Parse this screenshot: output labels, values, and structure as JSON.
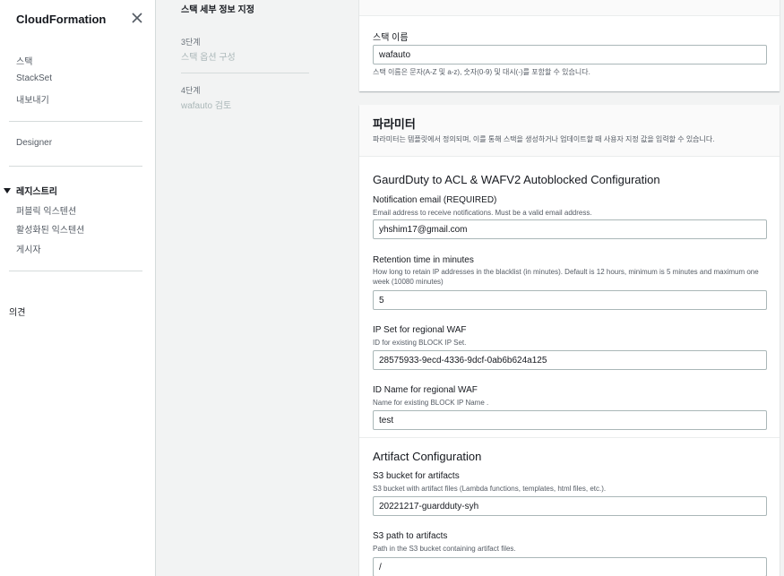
{
  "sidebar": {
    "title": "CloudFormation",
    "items": [
      "스택",
      "StackSet",
      "내보내기"
    ],
    "designer": "Designer",
    "registry": {
      "label": "레지스트리",
      "items": [
        "퍼블릭 익스텐션",
        "활성화된 익스텐션",
        "게시자"
      ]
    },
    "feedback": "의견"
  },
  "steps": {
    "current": "스택 세부 정보 지정",
    "step3_num": "3단계",
    "step3_name": "스택 옵션 구성",
    "step4_num": "4단계",
    "step4_name": "wafauto 검토"
  },
  "stack_name": {
    "label": "스택 이름",
    "value": "wafauto",
    "hint": "스택 이름은 문자(A-Z 및 a-z), 숫자(0-9) 및 대시(-)를 포함할 수 있습니다."
  },
  "parameters": {
    "title": "파라미터",
    "desc": "파라미터는 템플릿에서 정의되며, 이를 통해 스택을 생성하거나 업데이트할 때 사용자 지정 값을 입력할 수 있습니다.",
    "section1": "GaurdDuty to ACL & WAFV2 Autoblocked Configuration",
    "email": {
      "label": "Notification email (REQUIRED)",
      "desc": "Email address to receive notifications. Must be a valid email address.",
      "value": "yhshim17@gmail.com"
    },
    "retention": {
      "label": "Retention time in minutes",
      "desc": "How long to retain IP addresses in the blacklist (in minutes). Default is 12 hours, minimum is 5 minutes and maximum one week (10080 minutes)",
      "value": "5"
    },
    "ipset": {
      "label": "IP Set for regional WAF",
      "desc": "ID for existing BLOCK IP Set.",
      "value": "28575933-9ecd-4336-9dcf-0ab6b624a125"
    },
    "idname": {
      "label": "ID Name for regional WAF",
      "desc": "Name for existing BLOCK IP Name .",
      "value": "test"
    },
    "section2": "Artifact Configuration",
    "s3bucket": {
      "label": "S3 bucket for artifacts",
      "desc": "S3 bucket with artifact files (Lambda functions, templates, html files, etc.).",
      "value": "20221217-guardduty-syh"
    },
    "s3path": {
      "label": "S3 path to artifacts",
      "desc": "Path in the S3 bucket containing artifact files.",
      "value": "/"
    }
  }
}
